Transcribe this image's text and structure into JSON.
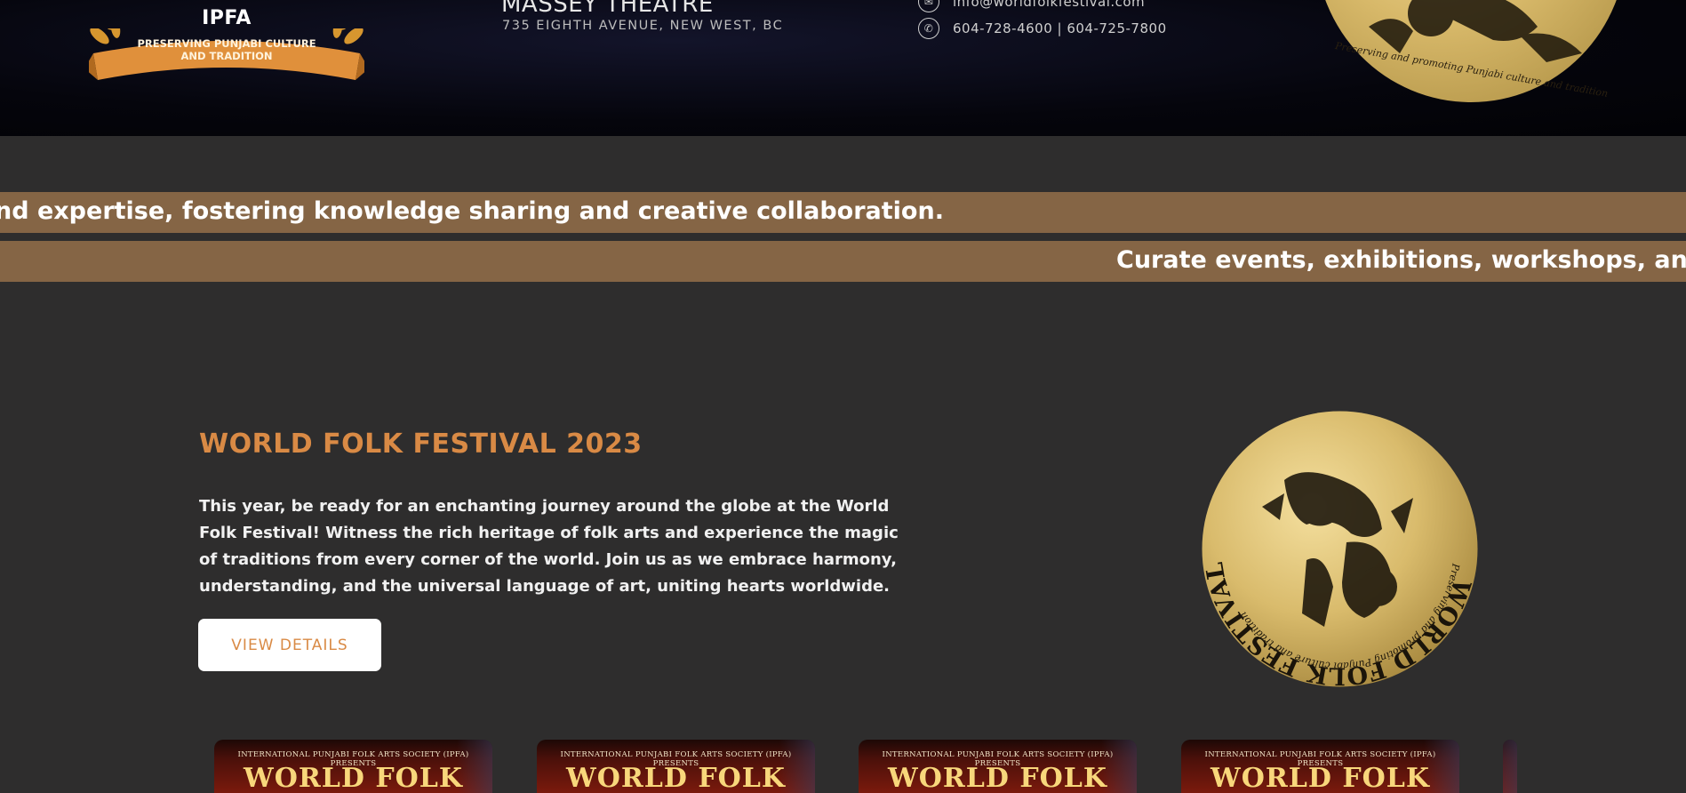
{
  "header": {
    "logo": {
      "name": "IPFA",
      "ribbon_line1": "PRESERVING PUNJABI CULTURE",
      "ribbon_line2": "AND TRADITION"
    },
    "venue": {
      "title": "MASSEY THEATRE",
      "address": "735 EIGHTH AVENUE, NEW WEST, BC"
    },
    "contact": {
      "email": "info@worldfolkfestival.com",
      "email_icon": "envelope-icon",
      "phone": "604-728-4600 | 604-725-7800",
      "phone_icon": "phone-icon"
    },
    "badge_caption": "Preserving and promoting Punjabi culture and tradition"
  },
  "marquee": {
    "line1": "nd expertise, fostering knowledge sharing and creative collaboration.",
    "line2": "Curate events, exhibitions, workshops, and p"
  },
  "feature": {
    "title": "WORLD FOLK FESTIVAL 2023",
    "description": "This year, be ready for an enchanting journey around the globe at the World Folk Festival! Witness the rich heritage of folk arts and experience the magic of traditions from every corner of the world. Join us as we embrace harmony, understanding, and the universal language of art, uniting hearts worldwide.",
    "button_label": "VIEW DETAILS",
    "badge": {
      "ring_text": "WORLD FOLK FESTIVAL",
      "inner_text": "Preserving and promoting Punjabi culture and tradition"
    }
  },
  "posters": [
    {
      "subtitle": "INTERNATIONAL PUNJABI FOLK ARTS SOCIETY (IPFA) PRESENTS",
      "title": "WORLD FOLK"
    },
    {
      "subtitle": "INTERNATIONAL PUNJABI FOLK ARTS SOCIETY (IPFA) PRESENTS",
      "title": "WORLD FOLK"
    },
    {
      "subtitle": "INTERNATIONAL PUNJABI FOLK ARTS SOCIETY (IPFA) PRESENTS",
      "title": "WORLD FOLK"
    },
    {
      "subtitle": "INTERNATIONAL PUNJABI FOLK ARTS SOCIETY (IPFA) PRESENTS",
      "title": "WORLD FOLK"
    }
  ],
  "colors": {
    "accent": "#d98a45",
    "band": "#856545",
    "background": "#2e2d2d",
    "gold": "#d8b96a"
  }
}
